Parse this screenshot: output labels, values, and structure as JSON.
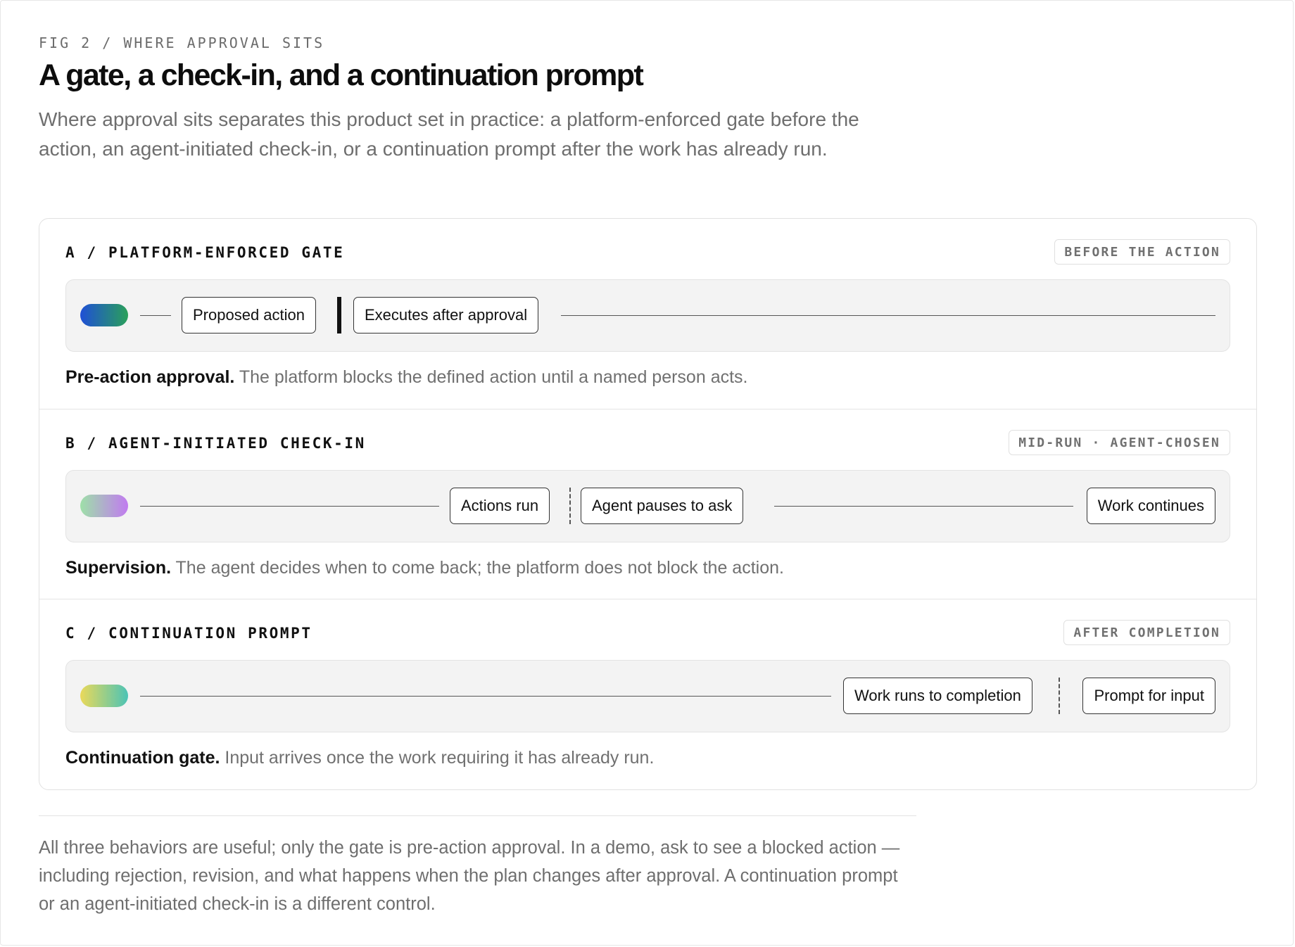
{
  "header": {
    "eyebrow": "FIG 2 / WHERE APPROVAL SITS",
    "title": "A gate, a check-in, and a continuation prompt",
    "intro": "Where approval sits separates this product set in practice: a platform-enforced gate before the action, an agent-initiated check-in, or a continuation prompt after the work has already run."
  },
  "sections": [
    {
      "label": "A / PLATFORM-ENFORCED GATE",
      "tag": "BEFORE THE ACTION",
      "pill_colors": [
        "#1f4fd6",
        "#2aa05a"
      ],
      "nodes": [
        "Proposed action",
        "Executes after approval"
      ],
      "caption_bold": "Pre-action approval.",
      "caption_text": " The platform blocks the defined action until a named person acts."
    },
    {
      "label": "B / AGENT-INITIATED CHECK-IN",
      "tag": "MID-RUN · AGENT-CHOSEN",
      "pill_colors": [
        "#9ee0a8",
        "#c17af0"
      ],
      "nodes": [
        "Actions run",
        "Agent pauses to ask",
        "Work continues"
      ],
      "caption_bold": "Supervision.",
      "caption_text": " The agent decides when to come back; the platform does not block the action."
    },
    {
      "label": "C / CONTINUATION PROMPT",
      "tag": "AFTER COMPLETION",
      "pill_colors": [
        "#ead95a",
        "#4cc3b5"
      ],
      "nodes": [
        "Work runs to completion",
        "Prompt for input"
      ],
      "caption_bold": "Continuation gate.",
      "caption_text": " Input arrives once the work requiring it has already run."
    }
  ],
  "footer": {
    "outro": "All three behaviors are useful; only the gate is pre-action approval. In a demo, ask to see a blocked action — including rejection, revision, and what happens when the plan changes after approval. A continuation prompt or an agent-initiated check-in is a different control."
  }
}
